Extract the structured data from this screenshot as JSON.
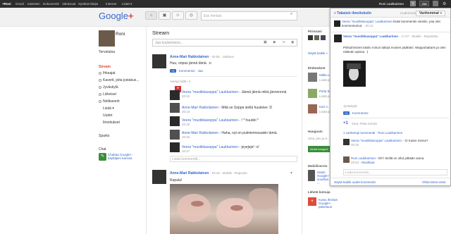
{
  "topbar": {
    "items": [
      "+Roni",
      "Gmail",
      "Kalenteri",
      "Dokumentit",
      "Valokuvat",
      "Syötteenlukija",
      "Internet",
      "Lisää ▾"
    ],
    "user": "Roni Laukkarinen",
    "notif_count": "1",
    "share_label": "Jaa"
  },
  "header": {
    "logo_google": "Google",
    "logo_plus": "+",
    "search_placeholder": "Etsi ihmisiä"
  },
  "profile": {
    "name": "Roni",
    "welcome": "Tervetuloa",
    "stream_label": "Stream",
    "circles": [
      "Ihkaajat",
      "Kaverit, joita jostakus...",
      "Jyväskylä",
      "Läheiset",
      "Netikaverit"
    ],
    "more": "Lisää ▾",
    "news": "Uudet",
    "notifications": "Ilmoitukset",
    "sparks": "Sparks",
    "chat_title": "Chat",
    "chat_invite": "Chattaa Google+-käyttäjien kanssa"
  },
  "stream": {
    "title": "Stream",
    "share_placeholder": "Jaa kuulumisesi...",
    "post1": {
      "author": "Anne-Mari Rakkolainen",
      "time": "20:55",
      "scope": "Julkinen",
      "text": "Huu, onpas jännä tämä. :o",
      "plus": "+1",
      "actions": "· Kommentoi · Jaa",
      "more": "Aiempi tällä +1",
      "comments": [
        {
          "author": "Veera \"mustikkasoppa\" Laukkarinen",
          "text": "- Jännä jännä mikä jännnnnnä",
          "time": "20:22"
        },
        {
          "author": "Anne-Mari Rakkolainen",
          "text": "- Mitä se Soppa siellä huutelee :D",
          "time": "20:23"
        },
        {
          "author": "Veera \"mustikkasoppa\" Laukkarinen",
          "text": "- ! * huudel *",
          "time": "20:26"
        },
        {
          "author": "Anne-Mari Rakkolainen",
          "text": "- Haha, nyt on pulmiemessakin tämä.",
          "time": "20:26"
        },
        {
          "author": "Veera \"mustikkasoppa\" Laukkarinen",
          "text": "- jeyejeje! :o!",
          "time": "20:27"
        }
      ],
      "comment_placeholder": "Lisää kommentti..."
    },
    "post2": {
      "author": "Anne-Mari Rakkolainen",
      "time": "20:42",
      "scope": "Mobile",
      "action": "Rapsoitu",
      "text": "Rapala!"
    }
  },
  "right": {
    "circles_title": "Piirissäsi",
    "show_all": "Näytä kaikki »",
    "updates_title": "Ehdotukset",
    "people": [
      {
        "name": "Mikko L...",
        "action": "Lisää piiriin"
      },
      {
        "name": "Pirita Sr...",
        "action": "Lisää piiriin"
      },
      {
        "name": "Kari A...",
        "action": "Lisää piiriin"
      }
    ],
    "hangout_title": "Hangouts",
    "hangout_text": "Sinä, jmu ja k...",
    "hangout_btn": "Aloita hangout",
    "mobile_title": "Mobiiliversio",
    "mobile_text": "Hanki Google+-sovellus ...",
    "invite_title": "Lähetä kutsuja",
    "invite_text": "Kutsu ihmisiä Google+-palveluun"
  },
  "notifications": {
    "back": "« Takaisin ilmoituksiin",
    "newer": "Uudemmat",
    "older": "Vanhemmat »",
    "header_author": "Veera \"mustikkasoppa\" Laukkarinen",
    "header_action": "lisäsi kommentin viestiin, jota olet kommentoinut.",
    "header_time": "20:12",
    "post_author": "Veera \"mustikkasoppa\" Laukkarinen",
    "post_time": "17.07",
    "post_scope": "Mobile",
    "post_action": "Rapsitettu",
    "post_text": "Piirkuihminen käsilo minun lattiaa moisen päähäni. Wappuhattarin ja olen nittävän apissa. :)",
    "location": "Jyväskylä",
    "plus": "+1",
    "comment": "· Kommentoi",
    "plus_people": "Sinä, Pirita Schulz",
    "older_comments": "1 vanhempi kommentti · Roni Laukkarinen",
    "c1_author": "Veera \"mustikkasoppa\" Laukkarinen",
    "c1_text": "- :D Kuten minne?",
    "c1_time": "20:32",
    "c2_author": "Roni Laukkarinen",
    "c2_text": "- Eh? Siellä on ollut pitkään sama.",
    "c2_time": "20:54",
    "c2_action": "Muokkaa",
    "add_comment": "Lisää kommentti...",
    "show_all_new": "Näytä kaikki uudet kommentit",
    "hide": "Ohita tämä viesti"
  },
  "colors": {
    "accent": "#dd4b39",
    "link": "#3366cc"
  }
}
